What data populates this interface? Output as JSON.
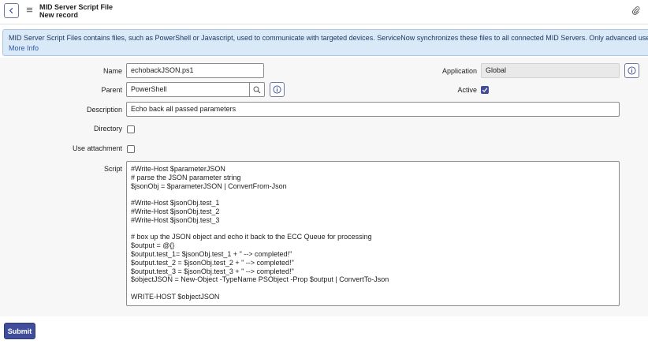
{
  "header": {
    "title": "MID Server Script File",
    "subtitle": "New record"
  },
  "banner": {
    "text": "MID Server Script Files contains files, such as PowerShell or Javascript, used to communicate with targeted devices. ServiceNow synchronizes these files to all connected MID Servers. Only advanced users should m",
    "more_info": "More Info"
  },
  "form": {
    "name_label": "Name",
    "name_value": "echobackJSON.ps1",
    "parent_label": "Parent",
    "parent_value": "PowerShell",
    "description_label": "Description",
    "description_value": "Echo back all passed parameters",
    "directory_label": "Directory",
    "directory_checked": false,
    "use_attachment_label": "Use attachment",
    "use_attachment_checked": false,
    "application_label": "Application",
    "application_value": "Global",
    "active_label": "Active",
    "active_checked": true,
    "script_label": "Script",
    "script_lines": [
      "#Write-Host $parameterJSON",
      "# parse the JSON parameter string",
      "$jsonObj = $parameterJSON | ConvertFrom-Json",
      "",
      "#Write-Host $jsonObj.test_1",
      "#Write-Host $jsonObj.test_2",
      "#Write-Host $jsonObj.test_3",
      "",
      "# box up the JSON object and echo it back to the ECC Queue for processing",
      "$output = @{}",
      "$output.test_1= $jsonObj.test_1 + \" --> completed!\"",
      "$output.test_2 = $jsonObj.test_2 + \" --> completed!\"",
      "$output.test_3 = $jsonObj.test_3 + \" --> completed!\"",
      "$objectJSON = New-Object -TypeName PSObject -Prop $output | ConvertTo-Json",
      "",
      "WRITE-HOST $objectJSON"
    ]
  },
  "actions": {
    "submit_label": "Submit"
  },
  "icons": {
    "back": "chevron-left-icon",
    "menu": "hamburger-menu-icon",
    "attach": "paperclip-icon",
    "search": "search-icon",
    "info": "info-icon",
    "check": "checkmark-icon"
  },
  "colors": {
    "accent": "#3f4d9b",
    "banner_bg": "#d9e9f8",
    "form_bg": "#f7f7f7"
  }
}
